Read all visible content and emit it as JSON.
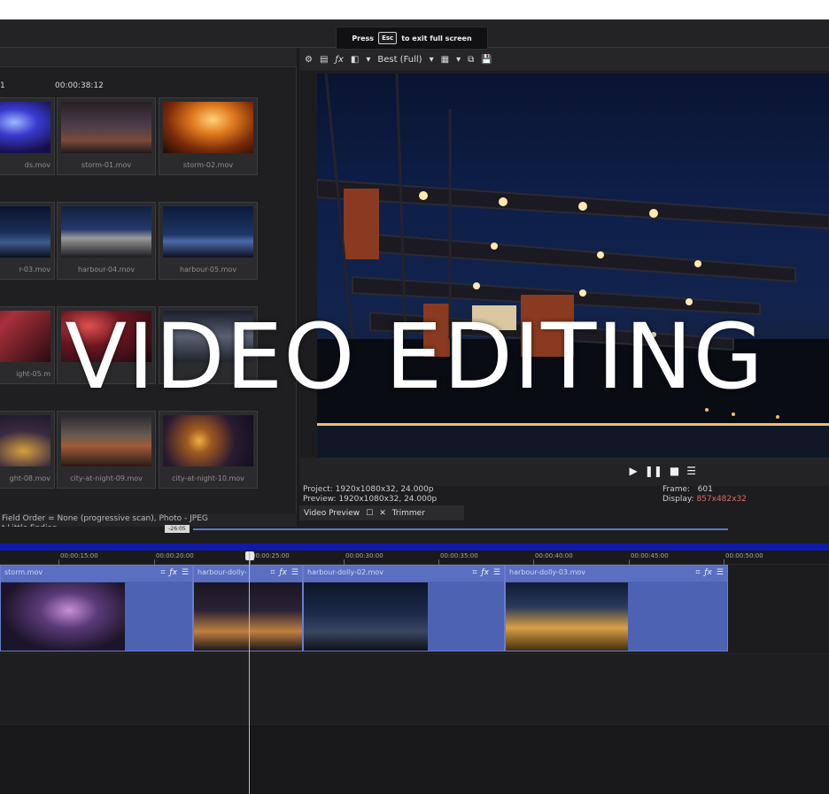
{
  "fullscreen_banner": {
    "prefix": "Press",
    "key": "Esc",
    "suffix": "to exit full screen"
  },
  "media_bin": {
    "timecode_left": "1",
    "timecode_right": "00:00:38:12",
    "items": [
      {
        "label": "ds.mov"
      },
      {
        "label": "storm-01.mov"
      },
      {
        "label": "storm-02.mov"
      },
      {
        "label": "r-03.mov"
      },
      {
        "label": "harbour-04.mov"
      },
      {
        "label": "harbour-05.mov"
      },
      {
        "label": "ight-05.m"
      },
      {
        "label": ""
      },
      {
        "label": ""
      },
      {
        "label": "ght-08.mov"
      },
      {
        "label": "city-at-night-09.mov"
      },
      {
        "label": "city-at-night-10.mov"
      }
    ],
    "status_line1": "Field Order = None (progressive scan), Photo - JPEG",
    "status_line2": "t Little Endian"
  },
  "preview": {
    "quality": "Best (Full)",
    "project_line": "Project:  1920x1080x32, 24.000p",
    "preview_line": "Preview:  1920x1080x32, 24.000p",
    "frame_label": "Frame:",
    "frame_value": "601",
    "display_label": "Display:",
    "display_value": "857x482x32",
    "tab_video_preview": "Video Preview",
    "tab_trimmer": "Trimmer"
  },
  "timeline": {
    "scrub_chip": "-26:05",
    "ruler": [
      "00:00:15:00",
      "00:00:20:00",
      "00:00:25:00",
      "00:00:30:00",
      "00:00:35:00",
      "00:00:40:00",
      "00:00:45:00",
      "00:00:50:00"
    ],
    "clips": [
      {
        "name": "storm.mov"
      },
      {
        "name": "harbour-dolly-"
      },
      {
        "name": "harbour-dolly-02.mov"
      },
      {
        "name": "harbour-dolly-03.mov"
      }
    ]
  },
  "headline": "VIDEO EDITING"
}
